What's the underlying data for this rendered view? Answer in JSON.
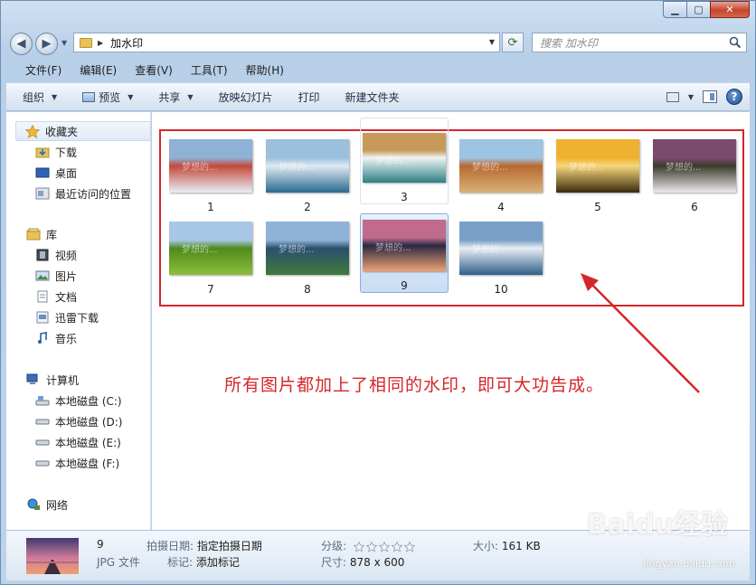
{
  "window": {
    "min_glyph": "▁",
    "max_glyph": "▢",
    "close_glyph": "✕"
  },
  "address": {
    "path_folder": "加水印",
    "search_placeholder": "搜索 加水印"
  },
  "menu": [
    "文件(F)",
    "编辑(E)",
    "查看(V)",
    "工具(T)",
    "帮助(H)"
  ],
  "toolbar": {
    "organize": "组织",
    "preview": "预览",
    "share": "共享",
    "slideshow": "放映幻灯片",
    "print": "打印",
    "new_folder": "新建文件夹",
    "help_glyph": "?"
  },
  "nav": {
    "favorites": "收藏夹",
    "downloads": "下载",
    "desktop": "桌面",
    "recent": "最近访问的位置",
    "libraries": "库",
    "videos": "视频",
    "pictures": "图片",
    "documents": "文档",
    "thunder": "迅雷下载",
    "music": "音乐",
    "computer": "计算机",
    "drive_c": "本地磁盘 (C:)",
    "drive_d": "本地磁盘 (D:)",
    "drive_e": "本地磁盘 (E:)",
    "drive_f": "本地磁盘 (F:)",
    "network": "网络"
  },
  "files": [
    {
      "label": "1",
      "palette": [
        "#8fb1d6",
        "#e9eef5",
        "#c34a3c"
      ]
    },
    {
      "label": "2",
      "palette": [
        "#9cc0dc",
        "#2a6a8e",
        "#dfe9f1"
      ]
    },
    {
      "label": "3",
      "palette": [
        "#c79a5a",
        "#2f7f87",
        "#eef4f2"
      ]
    },
    {
      "label": "4",
      "palette": [
        "#9fc4e3",
        "#d8b27a",
        "#b8692f"
      ]
    },
    {
      "label": "5",
      "palette": [
        "#f0b030",
        "#3a2a10",
        "#f6d77a"
      ]
    },
    {
      "label": "6",
      "palette": [
        "#7b4b6e",
        "#f0e8f0",
        "#3b3b2a"
      ]
    },
    {
      "label": "7",
      "palette": [
        "#a8c7e6",
        "#8cbf3a",
        "#4f8a1e"
      ]
    },
    {
      "label": "8",
      "palette": [
        "#8fb3d8",
        "#3f7a3a",
        "#2a4f6e"
      ]
    },
    {
      "label": "9",
      "palette": [
        "#c06a8c",
        "#f0a070",
        "#2a2a44"
      ]
    },
    {
      "label": "10",
      "palette": [
        "#7aa0c8",
        "#2f5f8a",
        "#e8eef4"
      ]
    }
  ],
  "watermark": "梦想的...",
  "annotation": "所有图片都加上了相同的水印，即可大功告成。",
  "details": {
    "name": "9",
    "type": "JPG 文件",
    "date_label": "拍摄日期:",
    "date_value": "指定拍摄日期",
    "tags_label": "标记:",
    "tags_value": "添加标记",
    "rating_label": "分级:",
    "rating": 0,
    "size_label": "大小:",
    "size_value": "161 KB",
    "dims_label": "尺寸:",
    "dims_value": "878 x 600"
  },
  "brand": {
    "logo": "Baidu经验",
    "url": "jingyan.baidu.com"
  },
  "colors": {
    "annotation_red": "#d5262a",
    "selection_blue": "#84acdd"
  }
}
